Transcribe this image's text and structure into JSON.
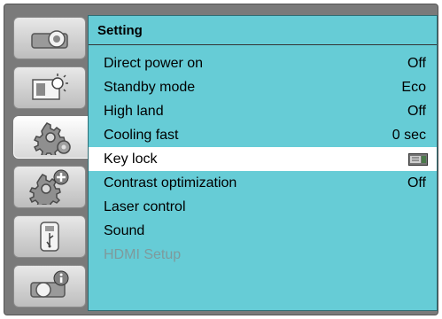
{
  "panel": {
    "title": "Setting"
  },
  "tabs": [
    {
      "icon": "projector-icon"
    },
    {
      "icon": "image-brightness-icon"
    },
    {
      "icon": "gear-icon"
    },
    {
      "icon": "gear-plus-icon"
    },
    {
      "icon": "usb-icon"
    },
    {
      "icon": "projector-info-icon"
    }
  ],
  "active_tab": 2,
  "rows": [
    {
      "label": "Direct power on",
      "value": "Off"
    },
    {
      "label": "Standby mode",
      "value": "Eco"
    },
    {
      "label": "High land",
      "value": "Off"
    },
    {
      "label": "Cooling fast",
      "value": "0 sec"
    },
    {
      "label": "Key lock",
      "value": "",
      "icon": "keypad-lock-icon"
    },
    {
      "label": "Contrast optimization",
      "value": "Off"
    },
    {
      "label": "Laser control",
      "value": ""
    },
    {
      "label": "Sound",
      "value": ""
    },
    {
      "label": "HDMI Setup",
      "value": ""
    }
  ],
  "selected_row": 4,
  "disabled_rows": [
    8
  ],
  "colors": {
    "panel": "#66ccd6",
    "selected": "#ffffff",
    "disabled_text": "#7e9a9c"
  }
}
